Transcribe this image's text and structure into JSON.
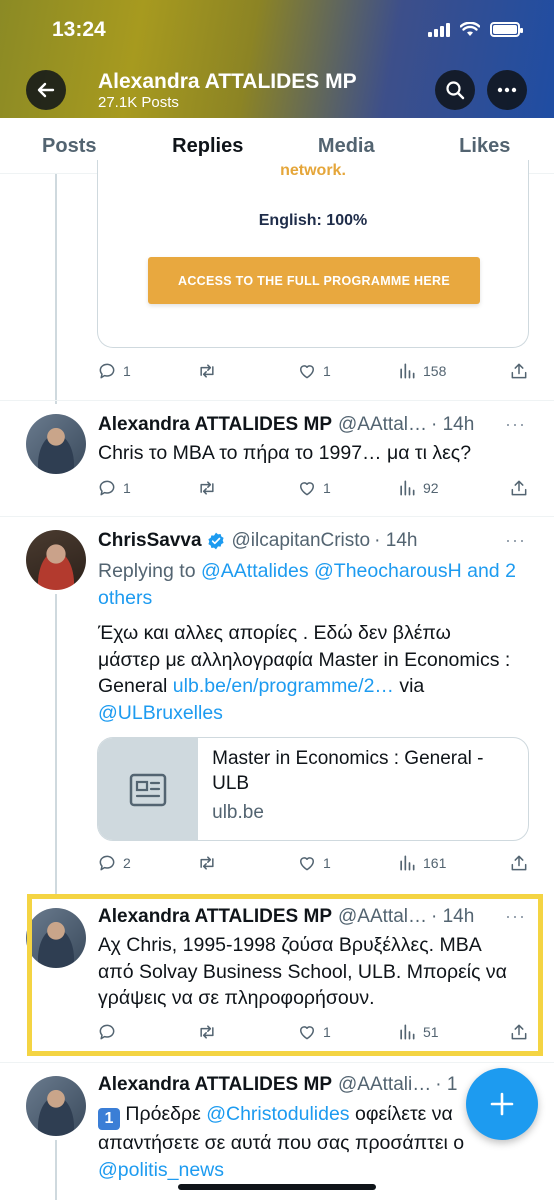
{
  "status_bar": {
    "time": "13:24"
  },
  "header": {
    "title": "Alexandra ATTALIDES MP",
    "subtitle": "27.1K Posts",
    "back_icon": "arrow-left-icon",
    "search_icon": "search-icon",
    "more_icon": "more-icon"
  },
  "tabs": [
    {
      "label": "Posts"
    },
    {
      "label": "Replies"
    },
    {
      "label": "Media"
    },
    {
      "label": "Likes"
    }
  ],
  "top_card": {
    "partial_text": "network.",
    "english": "English: 100%",
    "button": "ACCESS TO THE FULL PROGRAMME HERE",
    "actions": {
      "replies": "1",
      "likes": "1",
      "views": "158"
    }
  },
  "tweet1": {
    "name": "Alexandra ATTALIDES MP",
    "handle": "@AAttal…",
    "time": "· 14h",
    "text": "Chris το MBA το πήρα το 1997… μα τι λες?",
    "actions": {
      "replies": "1",
      "likes": "1",
      "views": "92"
    }
  },
  "tweet2": {
    "name": "ChrisSavva",
    "handle": "@ilcapitanCristo",
    "time": "· 14h",
    "replying_prefix": "Replying to ",
    "replying_to": "@AAttalides @TheocharousH and 2 others",
    "text_main": "Έχω και αλλες απορίες . Εδώ δεν βλέπω μάστερ με αλληλογραφία Master in Economics : General ",
    "text_link": "ulb.be/en/programme/2…",
    "text_via": " via ",
    "text_mention": "@ULBruxelles",
    "link_card": {
      "title": "Master in Economics : General - ULB",
      "domain": "ulb.be"
    },
    "actions": {
      "replies": "2",
      "likes": "1",
      "views": "161"
    }
  },
  "tweet3": {
    "name": "Alexandra ATTALIDES MP",
    "handle": "@AAttal…",
    "time": "· 14h",
    "text": "Αχ Chris, 1995-1998 ζούσα Βρυξέλλες.  MBA από Solvay Business School, ULB. Μπορείς να γράψεις να σε πληροφορήσουν.",
    "actions": {
      "likes": "1",
      "views": "51"
    }
  },
  "tweet4": {
    "name": "Alexandra ATTALIDES MP",
    "handle": "@AAttali…",
    "time": "· 1",
    "badge": "1",
    "text_a": " Πρόεδρε ",
    "mention_a": "@Christodulides",
    "text_b": " οφείλετε να απαντήσετε σε αυτά που σας προσάπτει ο ",
    "mention_b": "@politis_news"
  },
  "colors": {
    "accent": "#1d9bf0",
    "highlight": "#f4d443",
    "cta": "#e8a83f"
  }
}
